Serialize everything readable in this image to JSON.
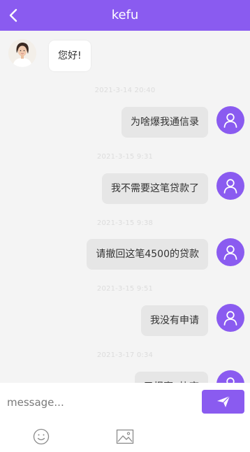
{
  "header": {
    "title": "kefu",
    "back_icon": "chevron-left-icon"
  },
  "messages": [
    {
      "side": "agent",
      "text": "您好!"
    },
    {
      "timestamp": "2021-3-14 20:40",
      "side": "user",
      "text": "为啥爆我通信录"
    },
    {
      "timestamp": "2021-3-15 9:31",
      "side": "user",
      "text": "我不需要这笔贷款了"
    },
    {
      "timestamp": "2021-3-15 9:38",
      "side": "user",
      "text": "请撤回这笔4500的贷款"
    },
    {
      "timestamp": "2021-3-15 9:51",
      "side": "user",
      "text": "我没有申请"
    },
    {
      "timestamp": "2021-3-17 0:34",
      "side": "user",
      "text": "已报案, 协商"
    }
  ],
  "composer": {
    "placeholder": "message...",
    "send_icon": "send-icon"
  },
  "toolbar": {
    "emoji_icon": "emoji-icon",
    "image_icon": "image-icon"
  },
  "colors": {
    "accent": "#8a5bf0",
    "user_bubble": "#e6e6e6",
    "agent_bubble": "#ffffff",
    "background": "#f4f4f4"
  }
}
